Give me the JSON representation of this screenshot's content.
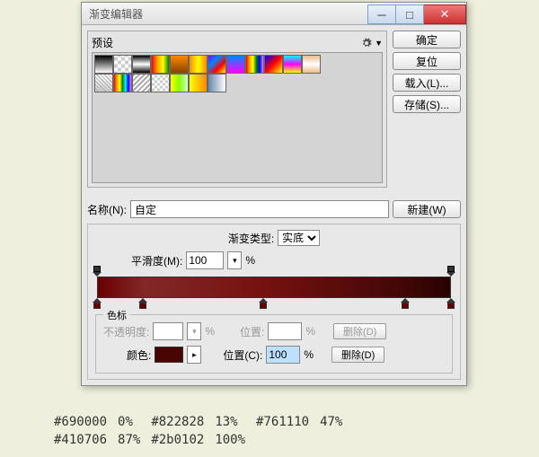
{
  "window": {
    "title": "渐变编辑器"
  },
  "buttons": {
    "ok": "确定",
    "reset": "复位",
    "load": "载入(L)...",
    "save": "存储(S)...",
    "new": "新建(W)"
  },
  "presets": {
    "label": "预设"
  },
  "name": {
    "label": "名称(N):",
    "value": "自定"
  },
  "gradient_type": {
    "label": "渐变类型:",
    "value": "实底"
  },
  "smoothness": {
    "label": "平滑度(M):",
    "value": "100",
    "unit": "%"
  },
  "color_stop_section": {
    "legend": "色标",
    "opacity_label": "不透明度:",
    "opacity_unit": "%",
    "position_label_o": "位置:",
    "position_unit": "%",
    "delete_o": "删除(D)",
    "color_label": "颜色:",
    "position_label_c": "位置(C):",
    "position_value": "100",
    "delete_c": "删除(D)"
  },
  "stops": [
    {
      "hex": "#690000",
      "pct": "0%"
    },
    {
      "hex": "#822828",
      "pct": "13%"
    },
    {
      "hex": "#761110",
      "pct": "47%"
    },
    {
      "hex": "#410706",
      "pct": "87%"
    },
    {
      "hex": "#2b0102",
      "pct": "100%"
    }
  ]
}
